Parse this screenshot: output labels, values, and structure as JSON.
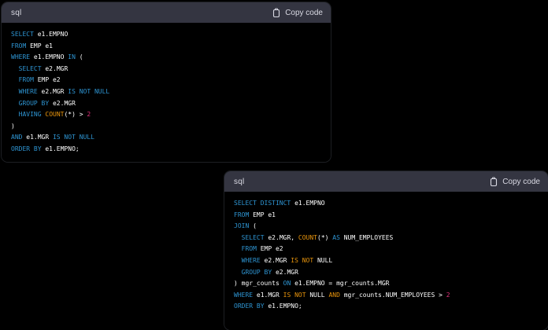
{
  "page": {
    "background": "#000000"
  },
  "colors": {
    "keyword": "#2e95d3",
    "builtin": "#e9950c",
    "number": "#df3079",
    "plain": "#ffffff",
    "header_bg": "#343541",
    "header_text": "#d9d9e3",
    "code_bg": "#000000"
  },
  "blocks": [
    {
      "language": "sql",
      "copy_label": "Copy code",
      "lines": [
        [
          {
            "t": "SELECT",
            "c": "kw"
          },
          {
            "t": " e1.EMPNO",
            "c": "pl"
          }
        ],
        [
          {
            "t": "FROM",
            "c": "kw"
          },
          {
            "t": " EMP e1",
            "c": "pl"
          }
        ],
        [
          {
            "t": "WHERE",
            "c": "kw"
          },
          {
            "t": " e1.EMPNO ",
            "c": "pl"
          },
          {
            "t": "IN",
            "c": "kw"
          },
          {
            "t": " (",
            "c": "pl"
          }
        ],
        [
          {
            "t": "  ",
            "c": "pl"
          },
          {
            "t": "SELECT",
            "c": "kw"
          },
          {
            "t": " e2.MGR",
            "c": "pl"
          }
        ],
        [
          {
            "t": "  ",
            "c": "pl"
          },
          {
            "t": "FROM",
            "c": "kw"
          },
          {
            "t": " EMP e2",
            "c": "pl"
          }
        ],
        [
          {
            "t": "  ",
            "c": "pl"
          },
          {
            "t": "WHERE",
            "c": "kw"
          },
          {
            "t": " e2.MGR ",
            "c": "pl"
          },
          {
            "t": "IS NOT NULL",
            "c": "kw"
          }
        ],
        [
          {
            "t": "  ",
            "c": "pl"
          },
          {
            "t": "GROUP BY",
            "c": "kw"
          },
          {
            "t": " e2.MGR",
            "c": "pl"
          }
        ],
        [
          {
            "t": "  ",
            "c": "pl"
          },
          {
            "t": "HAVING",
            "c": "kw"
          },
          {
            "t": " ",
            "c": "pl"
          },
          {
            "t": "COUNT",
            "c": "fn"
          },
          {
            "t": "(*) > ",
            "c": "pl"
          },
          {
            "t": "2",
            "c": "num"
          }
        ],
        [
          {
            "t": ")",
            "c": "pl"
          }
        ],
        [
          {
            "t": "AND",
            "c": "kw"
          },
          {
            "t": " e1.MGR ",
            "c": "pl"
          },
          {
            "t": "IS NOT NULL",
            "c": "kw"
          }
        ],
        [
          {
            "t": "ORDER BY",
            "c": "kw"
          },
          {
            "t": " e1.EMPNO;",
            "c": "pl"
          }
        ]
      ]
    },
    {
      "language": "sql",
      "copy_label": "Copy code",
      "lines": [
        [
          {
            "t": "SELECT DISTINCT",
            "c": "kw"
          },
          {
            "t": " e1.EMPNO",
            "c": "pl"
          }
        ],
        [
          {
            "t": "FROM",
            "c": "kw"
          },
          {
            "t": " EMP e1",
            "c": "pl"
          }
        ],
        [
          {
            "t": "JOIN",
            "c": "kw"
          },
          {
            "t": " (",
            "c": "pl"
          }
        ],
        [
          {
            "t": "  ",
            "c": "pl"
          },
          {
            "t": "SELECT",
            "c": "kw"
          },
          {
            "t": " e2.MGR, ",
            "c": "pl"
          },
          {
            "t": "COUNT",
            "c": "fn"
          },
          {
            "t": "(*) ",
            "c": "pl"
          },
          {
            "t": "AS",
            "c": "kw"
          },
          {
            "t": " NUM_EMPLOYEES",
            "c": "pl"
          }
        ],
        [
          {
            "t": "  ",
            "c": "pl"
          },
          {
            "t": "FROM",
            "c": "kw"
          },
          {
            "t": " EMP e2",
            "c": "pl"
          }
        ],
        [
          {
            "t": "  ",
            "c": "pl"
          },
          {
            "t": "WHERE",
            "c": "kw"
          },
          {
            "t": " e2.MGR ",
            "c": "pl"
          },
          {
            "t": "IS NOT",
            "c": "fn"
          },
          {
            "t": " NULL",
            "c": "pl"
          }
        ],
        [
          {
            "t": "  ",
            "c": "pl"
          },
          {
            "t": "GROUP BY",
            "c": "kw"
          },
          {
            "t": " e2.MGR",
            "c": "pl"
          }
        ],
        [
          {
            "t": ") mgr_counts ",
            "c": "pl"
          },
          {
            "t": "ON",
            "c": "kw"
          },
          {
            "t": " e1.EMPNO = mgr_counts.MGR",
            "c": "pl"
          }
        ],
        [
          {
            "t": "WHERE",
            "c": "kw"
          },
          {
            "t": " e1.MGR ",
            "c": "pl"
          },
          {
            "t": "IS NOT",
            "c": "fn"
          },
          {
            "t": " NULL ",
            "c": "pl"
          },
          {
            "t": "AND",
            "c": "fn"
          },
          {
            "t": " mgr_counts.NUM_EMPLOYEES > ",
            "c": "pl"
          },
          {
            "t": "2",
            "c": "num"
          }
        ],
        [
          {
            "t": "ORDER BY",
            "c": "kw"
          },
          {
            "t": " e1.EMPNO;",
            "c": "pl"
          }
        ]
      ]
    }
  ]
}
